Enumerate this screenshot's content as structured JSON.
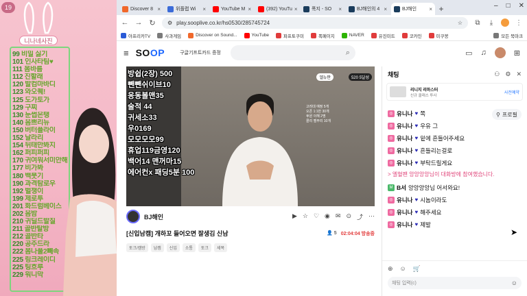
{
  "overlay": {
    "badge": "19",
    "menu_title": "니나네사진",
    "menu": [
      {
        "num": "99",
        "txt": "비밀 싫기"
      },
      {
        "num": "101",
        "txt": "인사타팀♥"
      },
      {
        "num": "111",
        "txt": "몸바름"
      },
      {
        "num": "112",
        "txt": "진할래"
      },
      {
        "num": "120",
        "txt": "발컴마바디"
      },
      {
        "num": "123",
        "txt": "와오퀘!"
      },
      {
        "num": "125",
        "txt": "도가토가"
      },
      {
        "num": "129",
        "txt": "구찌"
      },
      {
        "num": "130",
        "txt": "눈썹은탱"
      },
      {
        "num": "140",
        "txt": "음쁘리뉴"
      },
      {
        "num": "150",
        "txt": "버터플라이"
      },
      {
        "num": "152",
        "txt": "날라리"
      },
      {
        "num": "154",
        "txt": "뒤태만봐지"
      },
      {
        "num": "162",
        "txt": "퍼피퍼피"
      },
      {
        "num": "170",
        "txt": "귀여워서미안해"
      },
      {
        "num": "177",
        "txt": "비가봐"
      },
      {
        "num": "180",
        "txt": "백붓기"
      },
      {
        "num": "190",
        "txt": "과격탐로우"
      },
      {
        "num": "192",
        "txt": "벌챙이"
      },
      {
        "num": "199",
        "txt": "제로투"
      },
      {
        "num": "201",
        "txt": "화드럼베이스"
      },
      {
        "num": "202",
        "txt": "음밤"
      },
      {
        "num": "210",
        "txt": "귀딜드발질"
      },
      {
        "num": "211",
        "txt": "골반탈방"
      },
      {
        "num": "212",
        "txt": "골반타"
      },
      {
        "num": "220",
        "txt": "공주드라"
      },
      {
        "num": "222",
        "txt": "몸나풀2빼속"
      },
      {
        "num": "225",
        "txt": "링크레이디"
      },
      {
        "num": "225",
        "txt": "팅흐루"
      },
      {
        "num": "229",
        "txt": "워니막"
      }
    ]
  },
  "browser": {
    "tabs": [
      {
        "label": "Discover 8",
        "color": "#f0682b"
      },
      {
        "label": "위플랩 Wi",
        "color": "#3b6bd8"
      },
      {
        "label": "YouTube M",
        "color": "#ff0000"
      },
      {
        "label": "(392) YouTu",
        "color": "#ff0000"
      },
      {
        "label": "폭지 - SO",
        "color": "#1a3c5c"
      },
      {
        "label": "BJ해인의 4",
        "color": "#1a3c5c"
      },
      {
        "label": "BJ해인",
        "color": "#1a3c5c"
      }
    ],
    "url": "play.sooplive.co.kr/hs0530/285745724",
    "bookmarks": [
      {
        "label": "아프리카TV",
        "color": "#2a5bd7"
      },
      {
        "label": "사과게임",
        "color": "#7a7a7a"
      },
      {
        "label": "Discover on Sound...",
        "color": "#f0682b"
      },
      {
        "label": "YouTube",
        "color": "#ff0000"
      },
      {
        "label": "파프토쿠미",
        "color": "#e03b3b"
      },
      {
        "label": "폭페이지",
        "color": "#e03b3b"
      },
      {
        "label": "NAVER",
        "color": "#2db400"
      },
      {
        "label": "유진미트",
        "color": "#e03b3b"
      },
      {
        "label": "코카인",
        "color": "#e03b3b"
      },
      {
        "label": "미쿠봉",
        "color": "#e03b3b"
      }
    ],
    "bookmarks_all": "모든 북마크"
  },
  "soop": {
    "logo_main": "SO",
    "logo_accent": "OP",
    "promo": "구글기프트카드 증정",
    "video": {
      "overlay_lines": [
        "방쉽(2장) 500",
        "뺀뺀쉬이브10",
        "응동볼맨35",
        "술적 44",
        "귀세소33",
        "우0169",
        "모모모모99",
        "휴업119금영120",
        "백어14 맨꺼마15",
        "에어컨x 패딩5분 100"
      ],
      "tag1": "엘뉴판",
      "tag2": "520 5달성",
      "note": [
        "고려대 예정 5개",
        "오픈 1:1만 30개",
        "후원 이해 2명",
        "콜리 벨부리 10개"
      ]
    },
    "bj_name": "BJ해인",
    "title": "[신입남캠] 개하꼬 들어오면 잘생김 신남",
    "viewers": "5",
    "elapsed": "02:04:04 방송중",
    "tags": [
      "토크/캠방",
      "남캠",
      "신입",
      "소통",
      "토크",
      "세목"
    ]
  },
  "chat": {
    "title": "채팅",
    "ad_title": "리니지 리마스터",
    "ad_sub": "신규 클래스 투사",
    "ad_link": "사전예약",
    "profile_btn": "프로필",
    "messages": [
      {
        "lv": "pink",
        "nick": "유니나",
        "heart": "♥",
        "text": "쪽"
      },
      {
        "lv": "pink",
        "nick": "유니나",
        "heart": "♥",
        "text": "우유 그"
      },
      {
        "lv": "pink",
        "nick": "유니나",
        "heart": "♥",
        "text": "밑에 흔들어주세요"
      },
      {
        "lv": "pink",
        "nick": "유니나",
        "heart": "♥",
        "text": "흔들리는걸로"
      },
      {
        "lv": "pink",
        "nick": "유니나",
        "heart": "♥",
        "text": "부탁드릴게요"
      }
    ],
    "system": "> 엘혈팬 앙앙앙앙님이 대화방에 참여했습니다.",
    "messages2": [
      {
        "lv": "green",
        "nick": "B서",
        "heart": "",
        "text": "앙앙앙앙님 어서와요!"
      },
      {
        "lv": "pink",
        "nick": "유니나",
        "heart": "♥",
        "text": "시놈이라도"
      },
      {
        "lv": "pink",
        "nick": "유니나",
        "heart": "♥",
        "text": "해주세요"
      },
      {
        "lv": "pink",
        "nick": "유니나",
        "heart": "♥",
        "text": "제발"
      }
    ],
    "input_placeholder": "채팅 입력(c)"
  }
}
